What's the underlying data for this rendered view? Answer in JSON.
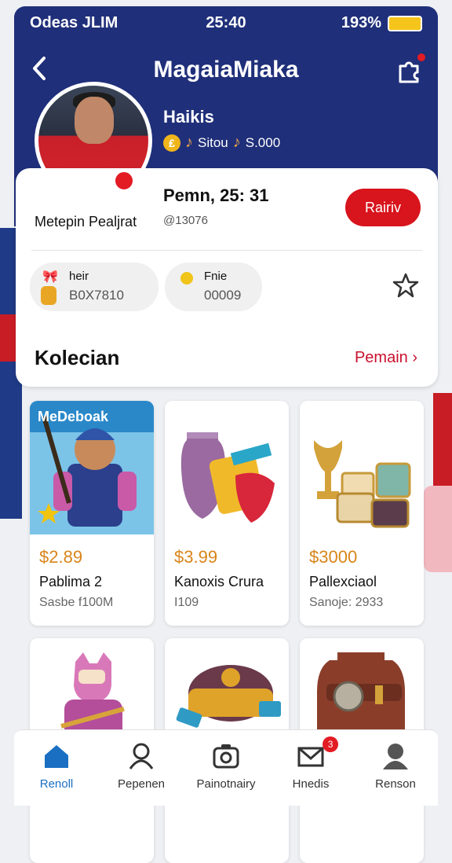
{
  "status_bar": {
    "carrier": "Odeas JLIM",
    "time": "25:40",
    "battery": "193%"
  },
  "header": {
    "title": "MagaiaMiaka"
  },
  "profile": {
    "handle": "Haikis",
    "stat_1_label": "Sitou",
    "stat_2_value": "S.000",
    "member_label": "Metepin Pealjrat",
    "points": "Pemn, 25: 31",
    "points_sub": "@13076",
    "action_label": "Rairiv"
  },
  "chips": [
    {
      "label": "heir",
      "value": "B0X7810"
    },
    {
      "label": "Fnie",
      "value": "00009"
    }
  ],
  "section": {
    "title": "Kolecian",
    "see_more": "Pemain"
  },
  "products": [
    {
      "banner": "MeDeboak",
      "price": "$2.89",
      "name": "Pablima 2",
      "sub": "Sasbe f100M"
    },
    {
      "price": "$3.99",
      "name": "Kanoxis Crura",
      "sub": "I109"
    },
    {
      "price": "$3000",
      "name": "Pallexciaol",
      "sub": "Sanoje: 2933"
    },
    {
      "price": "",
      "name": "",
      "sub": ""
    },
    {
      "price": "",
      "name": "",
      "sub": ""
    },
    {
      "price": "",
      "name": "",
      "sub": ""
    }
  ],
  "nav": [
    {
      "label": "Renoll",
      "icon": "home-icon"
    },
    {
      "label": "Pepenen",
      "icon": "person-icon"
    },
    {
      "label": "Painotnairy",
      "icon": "camera-icon"
    },
    {
      "label": "Hnedis",
      "icon": "mail-icon",
      "badge": "3"
    },
    {
      "label": "Renson",
      "icon": "profile-icon"
    }
  ],
  "colors": {
    "header": "#1f2f7a",
    "accent_red": "#d8141c",
    "price": "#d9851a",
    "active_nav": "#1a6fc2"
  }
}
